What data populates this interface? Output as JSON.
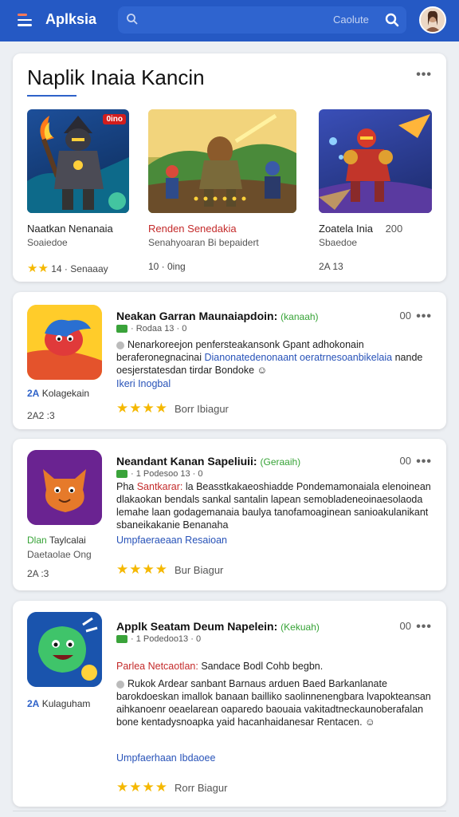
{
  "header": {
    "app_title": "Aplksia",
    "search_placeholder": "",
    "search_hint": "Caolute"
  },
  "featured": {
    "title": "Naplik Inaia Kancin",
    "more": "•••",
    "items": [
      {
        "name": "Naatkan Nenanaia",
        "sub": "Soaiedoe",
        "meta": "14 · Senaaay",
        "stars": "★★",
        "badge": "0ino"
      },
      {
        "name": "Renden Senedakia",
        "sub": "Senahyoaran Bi bepaidert",
        "meta": "10 · 0ing"
      },
      {
        "name": "Zoatela Inia",
        "sub": "Sbaedoe",
        "meta": "2A 13",
        "price": "200"
      }
    ]
  },
  "apps": [
    {
      "title": "Neakan Garran Maunaiapdoin:",
      "genre": "(kanaah)",
      "count": "00",
      "badge": "· Rodaa 13 · 0",
      "desc_parts": [
        {
          "text": "Nenarkoreejon penfersteakansonk Gpant adhokonain beraferonegnacinai ",
          "cls": ""
        },
        {
          "text": "Dianonatedenonaant oeratrnesoanbikelaia",
          "cls": "blue"
        },
        {
          "text": " nande oesjerstatesdan tirdar Bondoke ☺",
          "cls": ""
        }
      ],
      "link": "Ikeri Inogbal",
      "tag_code": "2A",
      "tag": "Kolagekain",
      "date": "2A2 :3",
      "rating_text": "Borr Ibiagur"
    },
    {
      "title": "Neandant Kanan Sapeliuii:",
      "genre": "(Geraaih)",
      "count": "00",
      "badge": "· 1 Podesoo 13 · 0",
      "desc_parts": [
        {
          "text": "Pha ",
          "cls": ""
        },
        {
          "text": "Santkarar:",
          "cls": "red"
        },
        {
          "text": " la Beasstkakaeoshiadde Pondemamonaiala elenoinean dlakaokan bendals sankal santalin lapean semobladeneoinaesolaoda lemahe laan godagemanaia baulya tanofamoaginean sanioakulanikant sbaneikakanie Benanaha",
          "cls": ""
        }
      ],
      "link": "Umpfaeraeaan Resaioan",
      "tag": "Taylcalai",
      "tag_prefix": "Dlan",
      "tag2": "Daetaolae Ong",
      "date": "2A :3",
      "rating_text": "Bur Biagur"
    },
    {
      "title": "Applk Seatam Deum Napelein:",
      "genre": "(Kekuah)",
      "count": "00",
      "badge": "· 1 Podedoo13 · 0",
      "note_red": "Parlea Netcaotlan:",
      "note_rest": " Sandace Bodl Cohb begbn.",
      "desc_parts": [
        {
          "text": "Rukok Ardear sanbant Barnaus arduen Baed Barkanlanate barokdoeskan imallok banaan bailliko saolinnenengbara lvapokteansan aihkanoenr oeaelarean oaparedo baouaia vakitadtneckaunoberafalan bone kentadysnoapka yaid hacanhaidanesar Rentacen. ☺",
          "cls": ""
        }
      ],
      "link": "Umpfaerhaan Ibdaoee",
      "tag_code": "2A",
      "tag": "Kulaguham",
      "rating_text": "Rorr Biagur"
    }
  ],
  "colors": {
    "accent": "#2559c4",
    "star": "#f5b800",
    "green": "#36a336",
    "link": "#2752b8",
    "red": "#c42a2a"
  }
}
